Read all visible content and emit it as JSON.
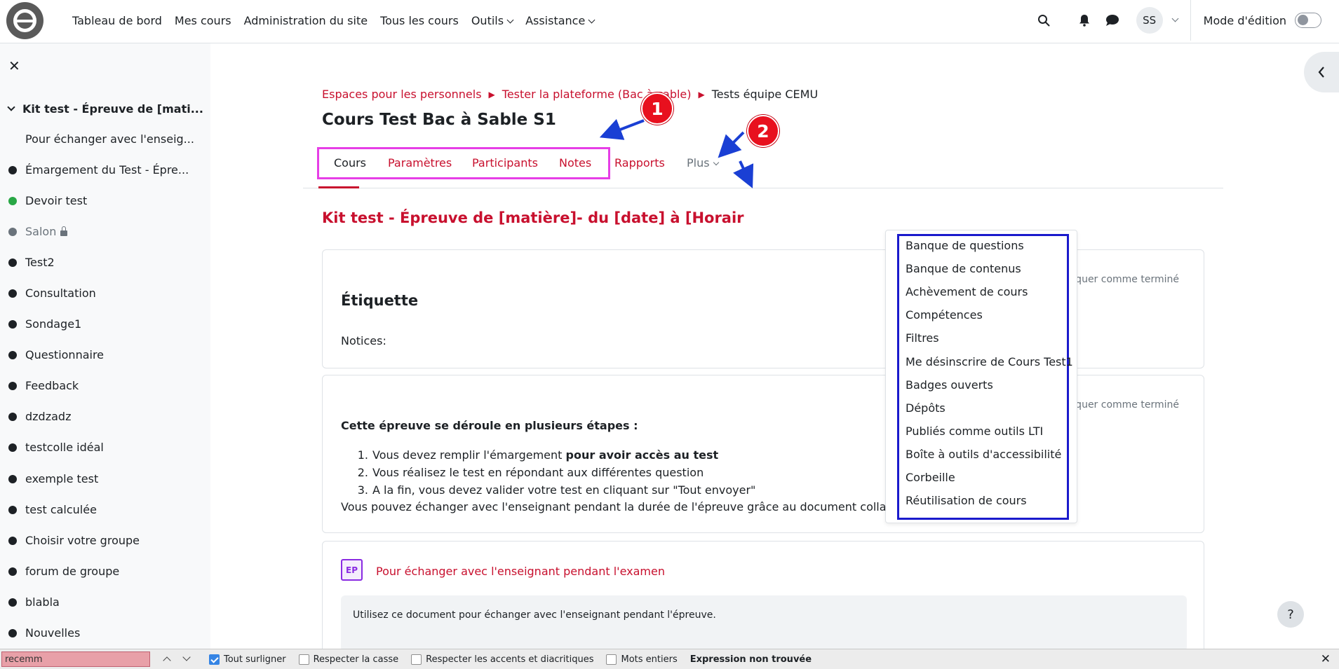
{
  "navbar": {
    "links": [
      "Tableau de bord",
      "Mes cours",
      "Administration du site",
      "Tous les cours",
      "Outils",
      "Assistance"
    ],
    "avatar_initials": "SS",
    "edit_mode_label": "Mode d'édition",
    "icons": [
      "logo-icon",
      "search-icon",
      "bell-icon",
      "chat-icon",
      "chevron-down-icon"
    ]
  },
  "sidebar": {
    "section_title": "Kit test - Épreuve de [mati...",
    "first_item": "Pour échanger avec l'enseig...",
    "items": [
      {
        "label": "Émargement du Test - Épre...",
        "dot": "dark"
      },
      {
        "label": "Devoir test",
        "dot": "green"
      },
      {
        "label": "Salon",
        "dot": "gray"
      },
      {
        "label": "Test2",
        "dot": "dark"
      },
      {
        "label": "Consultation",
        "dot": "dark"
      },
      {
        "label": "Sondage1",
        "dot": "dark"
      },
      {
        "label": "Questionnaire",
        "dot": "dark"
      },
      {
        "label": "Feedback",
        "dot": "dark"
      },
      {
        "label": "dzdzadz",
        "dot": "dark"
      },
      {
        "label": "testcolle idéal",
        "dot": "dark"
      },
      {
        "label": "exemple test",
        "dot": "dark"
      },
      {
        "label": "test calculée",
        "dot": "dark"
      },
      {
        "label": "Choisir votre groupe",
        "dot": "dark"
      },
      {
        "label": "forum de groupe",
        "dot": "dark"
      },
      {
        "label": "blabla",
        "dot": "dark"
      },
      {
        "label": "Nouvelles",
        "dot": "dark"
      }
    ]
  },
  "breadcrumb": {
    "items": [
      "Espaces pour les personnels",
      "Tester la plateforme (Bac à sable)"
    ],
    "current": "Tests équipe CEMU"
  },
  "course": {
    "title": "Cours Test Bac à Sable S1",
    "tabs": [
      "Cours",
      "Paramètres",
      "Participants",
      "Notes",
      "Rapports",
      "Plus"
    ],
    "active_tab": "Cours"
  },
  "more_menu": {
    "items": [
      "Banque de questions",
      "Banque de contenus",
      "Achèvement de cours",
      "Compétences",
      "Filtres",
      "Me désinscrire de Cours Test1",
      "Badges ouverts",
      "Dépôts",
      "Publiés comme outils LTI",
      "Boîte à outils d'accessibilité",
      "Corbeille",
      "Réutilisation de cours"
    ]
  },
  "content": {
    "section_title": "Kit test - Épreuve de [matière]- du [date] à [Horair",
    "mark_done": "Marquer comme terminé",
    "label_card": {
      "title": "Étiquette",
      "notices": "Notices:"
    },
    "steps_card": {
      "intro": "Cette épreuve se déroule en plusieurs étapes :",
      "steps": [
        {
          "num": "1.",
          "text": "Vous devez remplir l'émargement ",
          "bold": "pour avoir accès au test"
        },
        {
          "num": "2.",
          "text": "Vous réalisez le test en répondant aux différentes question",
          "bold": ""
        },
        {
          "num": "3.",
          "text": "A la fin, vous devez valider votre test en cliquant sur \"Tout envoyer\"",
          "bold": ""
        }
      ],
      "outro": "Vous pouvez échanger avec l'enseignant pendant la durée de l'épreuve grâce au document collaboratif en ligne."
    },
    "etherpad_card": {
      "link": "Pour échanger avec l'enseignant pendant l'examen",
      "description": "Utilisez ce document pour échanger avec l'enseignant pendant l'épreuve."
    }
  },
  "annotations": {
    "marker_1": "1",
    "marker_2": "2",
    "colors": {
      "magenta_box": "#e63ee6",
      "blue_box": "#1a1acc",
      "marker": "#e8101e",
      "arrow": "#1a3fd4"
    }
  },
  "help_button": "?",
  "findbar": {
    "query": "recemm",
    "options": [
      {
        "label": "Tout surligner",
        "checked": true
      },
      {
        "label": "Respecter la casse",
        "checked": false
      },
      {
        "label": "Respecter les accents et diacritiques",
        "checked": false
      },
      {
        "label": "Mots entiers",
        "checked": false
      }
    ],
    "status": "Expression non trouvée"
  },
  "theme": {
    "accent": "#c8102e",
    "text": "#1d2125",
    "muted": "#6a737b",
    "sidebar_bg": "#f8f9fa"
  }
}
